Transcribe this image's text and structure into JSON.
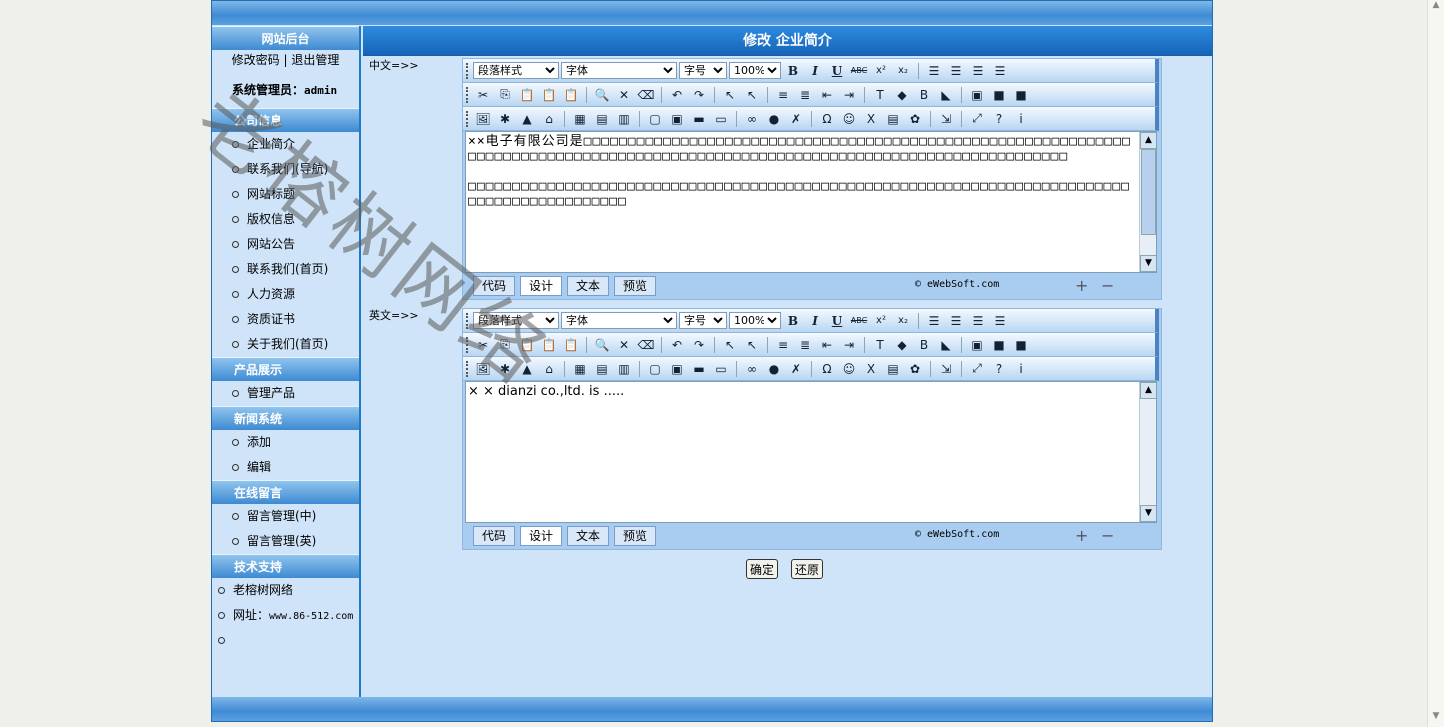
{
  "sidebar": {
    "header": "网站后台",
    "link_password": "修改密码",
    "link_separator": "|",
    "link_logout": "退出管理",
    "admin_label": "系统管理员：",
    "admin_name": "admin",
    "sections": [
      {
        "title": "公司信息",
        "items": [
          "企业简介",
          "联系我们(导航)",
          "网站标题",
          "版权信息",
          "网站公告",
          "联系我们(首页)",
          "人力资源",
          "资质证书",
          "关于我们(首页)"
        ]
      },
      {
        "title": "产品展示",
        "items": [
          "管理产品"
        ]
      },
      {
        "title": "新闻系统",
        "items": [
          "添加",
          "编辑"
        ]
      },
      {
        "title": "在线留言",
        "items": [
          "留言管理(中)",
          "留言管理(英)"
        ]
      },
      {
        "title": "技术支持",
        "items": [
          "老榕树网络",
          "网址：",
          ""
        ]
      }
    ],
    "site_url": "www.86-512.com"
  },
  "content": {
    "title": "修改 企业简介",
    "label_cn": "中文=>>",
    "label_en": "英文=>>",
    "confirm_button": "确定",
    "reset_button": "还原"
  },
  "editor": {
    "select_paragraph": "段落样式",
    "select_font": "字体",
    "select_size": "字号",
    "select_zoom": "100%",
    "tabs": [
      "代码",
      "设计",
      "文本",
      "预览"
    ],
    "copyright": "© eWebSoft.com",
    "cn_text_line1": "  ××电子有限公司是□□□□□□□□□□□□□□□□□□□□□□□□□□□□□□□□□□□□□□□□□□□□□□□□□□□□□□□□□□□□□□□□□□□□□□□□□□□□□□□□□□□□□□□□□□□□□□□□□□□□□□□□□□□□□□□□□□□□□□□□□□□□□□□□□□",
    "cn_text_line2": "  □□□□□□□□□□□□□□□□□□□□□□□□□□□□□□□□□□□□□□□□□□□□□□□□□□□□□□□□□□□□□□□□□□□□□□□□□□□□□□□□□□□□□□□□□□□□□",
    "en_text": "  × × dianzi co.,ltd. is ....."
  },
  "watermark": "老榕树网络",
  "icons": [
    "cut-icon",
    "copy-icon",
    "paste-icon",
    "find-icon",
    "undo-icon",
    "redo-icon",
    "bold-icon",
    "italic-icon",
    "underline-icon",
    "align-left-icon",
    "image-icon",
    "table-icon",
    "help-icon",
    "info-icon"
  ]
}
